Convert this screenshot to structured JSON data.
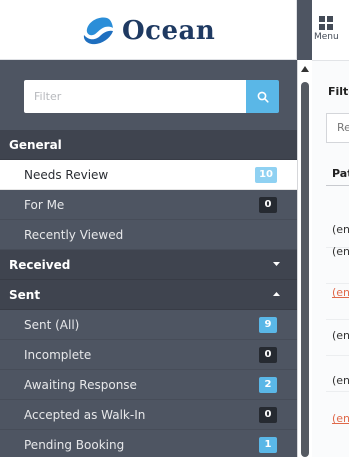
{
  "app": {
    "logo_text": "Ocean",
    "brand_color": "#2b8ed8",
    "logo_text_color": "#1f3a62"
  },
  "filter": {
    "placeholder": "Filter",
    "value": "",
    "icon": "search-icon"
  },
  "sidebar": {
    "sections": [
      {
        "label": "General",
        "caret": null,
        "items": [
          {
            "label": "Needs Review",
            "badge": "10",
            "badge_style": "blue",
            "active": true
          },
          {
            "label": "For Me",
            "badge": "0",
            "badge_style": "dark",
            "active": false
          },
          {
            "label": "Recently Viewed",
            "badge": null,
            "badge_style": null,
            "active": false
          }
        ]
      },
      {
        "label": "Received",
        "caret": "down",
        "items": []
      },
      {
        "label": "Sent",
        "caret": "up",
        "items": [
          {
            "label": "Sent (All)",
            "badge": "9",
            "badge_style": "blue",
            "active": false
          },
          {
            "label": "Incomplete",
            "badge": "0",
            "badge_style": "dark",
            "active": false
          },
          {
            "label": "Awaiting Response",
            "badge": "2",
            "badge_style": "blue",
            "active": false
          },
          {
            "label": "Accepted as Walk-In",
            "badge": "0",
            "badge_style": "dark",
            "active": false
          },
          {
            "label": "Pending Booking",
            "badge": "1",
            "badge_style": "blue",
            "active": false
          }
        ]
      }
    ]
  },
  "menu": {
    "label": "Menu",
    "icon": "grid-icon"
  },
  "content": {
    "filter_label": "Filte",
    "input_value": "Re",
    "column_header": "Pat",
    "rows": [
      {
        "text": "(en",
        "style": "normal"
      },
      {
        "text": "(en",
        "style": "normal"
      },
      {
        "text": "(en",
        "style": "link-red"
      },
      {
        "text": "(en",
        "style": "normal"
      },
      {
        "text": "(en",
        "style": "normal"
      },
      {
        "text": "(en",
        "style": "link-red"
      }
    ]
  },
  "colors": {
    "sidebar_bg": "#4e5562",
    "section_header_bg": "#3f444f",
    "badge_blue": "#5ab7e7",
    "badge_dark": "#262a31",
    "link_red": "#e0694a"
  }
}
